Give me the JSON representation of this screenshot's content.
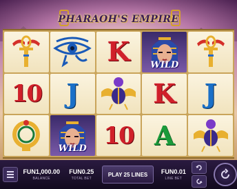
{
  "game": {
    "title": "PHARAOH'S EMPIRE"
  },
  "reels": [
    [
      {
        "symbol": "ankh-icon",
        "label": ""
      },
      {
        "symbol": "letter",
        "label": "10",
        "kind": "ten"
      },
      {
        "symbol": "ring-icon",
        "label": ""
      }
    ],
    [
      {
        "symbol": "eye-of-horus-icon",
        "label": ""
      },
      {
        "symbol": "letter",
        "label": "J",
        "kind": "j"
      },
      {
        "symbol": "pharaoh-wild",
        "label": "WILD"
      }
    ],
    [
      {
        "symbol": "letter",
        "label": "K",
        "kind": "k"
      },
      {
        "symbol": "scarab-icon",
        "label": ""
      },
      {
        "symbol": "letter",
        "label": "10",
        "kind": "ten"
      }
    ],
    [
      {
        "symbol": "pharaoh-wild",
        "label": "WILD"
      },
      {
        "symbol": "letter",
        "label": "K",
        "kind": "k"
      },
      {
        "symbol": "letter",
        "label": "A",
        "kind": "a"
      }
    ],
    [
      {
        "symbol": "ankh-icon",
        "label": ""
      },
      {
        "symbol": "letter",
        "label": "J",
        "kind": "j"
      },
      {
        "symbol": "scarab-icon",
        "label": ""
      }
    ]
  ],
  "hud": {
    "balance_value": "FUN1,000.00",
    "balance_label": "BALANCE",
    "total_bet_value": "FUN0.25",
    "total_bet_label": "TOTAL BET",
    "play_label": "PLAY 25 LINES",
    "line_bet_value": "FUN0.01",
    "line_bet_label": "LINE BET"
  },
  "colors": {
    "accent_gold": "#d4a02a",
    "hud_bg": "#1a0d2a",
    "reel_bg": "#fbf4e0"
  }
}
